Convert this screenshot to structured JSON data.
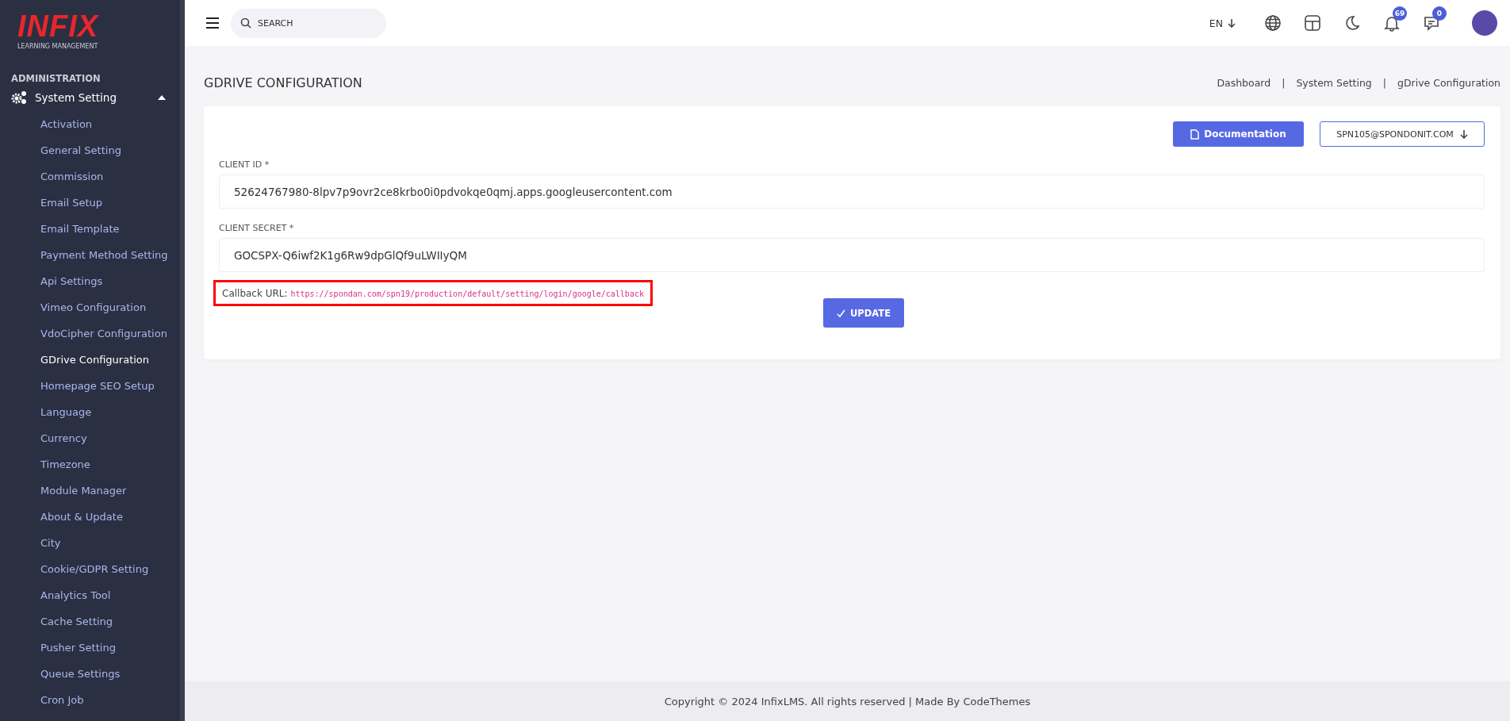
{
  "logo": {
    "brand": "INFIX",
    "tagline": "LEARNING MANAGEMENT"
  },
  "sidebar": {
    "section": "ADMINISTRATION",
    "group": {
      "label": "System Setting",
      "expanded": true
    },
    "items": [
      {
        "label": "Activation",
        "selected": false
      },
      {
        "label": "General Setting",
        "selected": false
      },
      {
        "label": "Commission",
        "selected": false
      },
      {
        "label": "Email Setup",
        "selected": false
      },
      {
        "label": "Email Template",
        "selected": false
      },
      {
        "label": "Payment Method Setting",
        "selected": false
      },
      {
        "label": "Api Settings",
        "selected": false
      },
      {
        "label": "Vimeo Configuration",
        "selected": false
      },
      {
        "label": "VdoCipher Configuration",
        "selected": false
      },
      {
        "label": "GDrive Configuration",
        "selected": true
      },
      {
        "label": "Homepage SEO Setup",
        "selected": false
      },
      {
        "label": "Language",
        "selected": false
      },
      {
        "label": "Currency",
        "selected": false
      },
      {
        "label": "Timezone",
        "selected": false
      },
      {
        "label": "Module Manager",
        "selected": false
      },
      {
        "label": "About & Update",
        "selected": false
      },
      {
        "label": "City",
        "selected": false
      },
      {
        "label": "Cookie/GDPR Setting",
        "selected": false
      },
      {
        "label": "Analytics Tool",
        "selected": false
      },
      {
        "label": "Cache Setting",
        "selected": false
      },
      {
        "label": "Pusher Setting",
        "selected": false
      },
      {
        "label": "Queue Settings",
        "selected": false
      },
      {
        "label": "Cron Job",
        "selected": false
      }
    ]
  },
  "header": {
    "search": {
      "placeholder": "SEARCH"
    },
    "language": "EN",
    "notifications": "69",
    "messages": "0"
  },
  "page": {
    "title": "GDRIVE CONFIGURATION",
    "breadcrumbs": [
      "Dashboard",
      "System Setting",
      "gDrive Configuration"
    ],
    "breadcrumb_separator": "|"
  },
  "card": {
    "documentation_button": "Documentation",
    "account_button": "SPN105@SPONDONIT.COM",
    "fields": [
      {
        "label": "CLIENT ID *",
        "value": "52624767980-8lpv7p9ovr2ce8krbo0i0pdvokqe0qmj.apps.googleusercontent.com"
      },
      {
        "label": "CLIENT SECRET *",
        "value": "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"
      }
    ],
    "callback": {
      "label": "Callback URL:",
      "url": "https://spondan.com/spn19/production/default/setting/login/google/callback"
    },
    "update_button": "UPDATE"
  },
  "footer": "Copyright © 2024 InfixLMS. All rights reserved | Made By CodeThemes"
}
